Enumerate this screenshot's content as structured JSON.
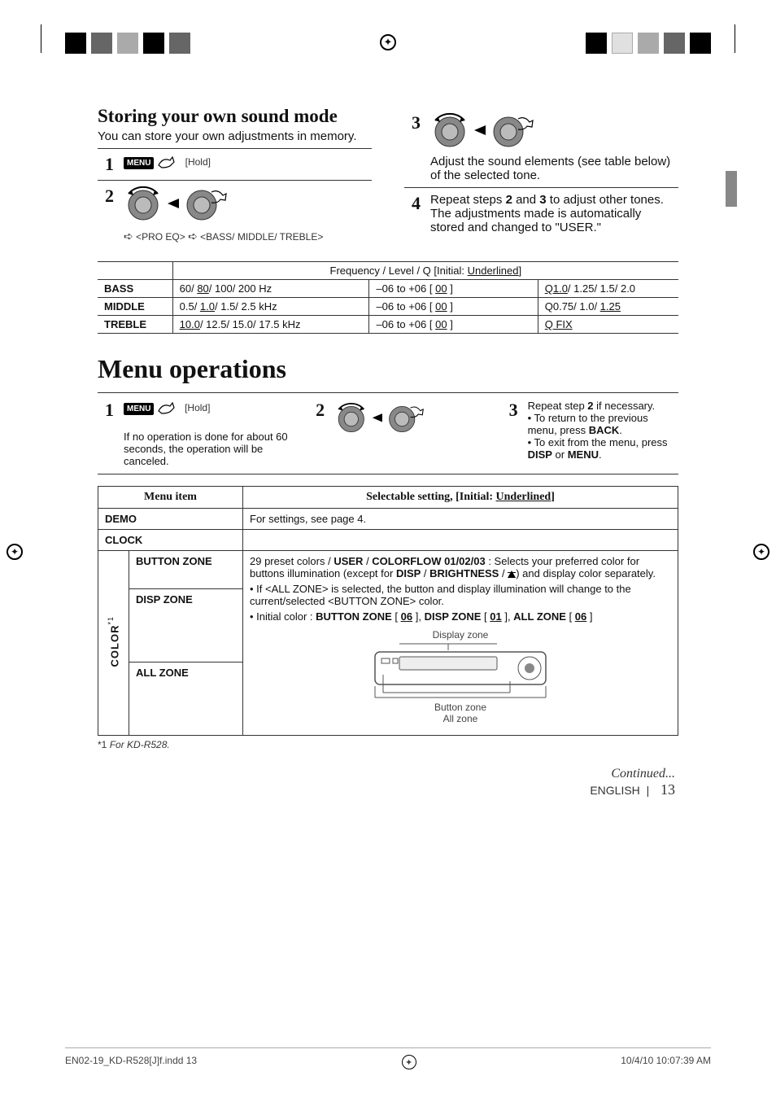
{
  "header": {
    "title": "Storing your own sound mode",
    "intro": "You can store your own adjustments in memory.",
    "steps": {
      "s1_hold": "[Hold]",
      "s2_path": " <PRO EQ>   <BASS/ MIDDLE/ TREBLE>",
      "s3": "Adjust the sound elements (see table below) of the selected tone.",
      "s4a": "Repeat steps ",
      "s4b": " and ",
      "s4c": " to adjust other tones.",
      "s4cont": "The adjustments made is automatically stored and changed to \"USER.\""
    },
    "step_nums": {
      "n1": "1",
      "n2": "2",
      "n3": "3",
      "n4": "4",
      "r2": "2",
      "r3": "3"
    }
  },
  "freq_table": {
    "header": "Frequency / Level / Q     [Initial: ",
    "header_u": "Underlined",
    "header_end": "]",
    "rows": [
      {
        "label": "BASS",
        "freq_pre": "60/ ",
        "freq_u": "80",
        "freq_post": "/ 100/ 200 Hz",
        "level_pre": "–06 to +06 [ ",
        "level_u": "00",
        "level_post": " ]",
        "q_u": "Q1.0",
        "q_post": "/ 1.25/ 1.5/ 2.0"
      },
      {
        "label": "MIDDLE",
        "freq_pre": "0.5/ ",
        "freq_u": "1.0",
        "freq_post": "/ 1.5/ 2.5 kHz",
        "level_pre": "–06 to +06 [ ",
        "level_u": "00",
        "level_post": " ]",
        "q_pre": "Q0.75/ 1.0/ ",
        "q_u": "1.25"
      },
      {
        "label": "TREBLE",
        "freq_u": "10.0",
        "freq_post": "/ 12.5/ 15.0/ 17.5 kHz",
        "level_pre": "–06 to +06 [ ",
        "level_u": "00",
        "level_post": " ]",
        "q_u": "Q FIX"
      }
    ]
  },
  "menu_ops": {
    "title": "Menu operations",
    "steps": {
      "n1": "1",
      "n2": "2",
      "n3": "3",
      "hold": "[Hold]",
      "s1_note": "If no operation is done for about 60 seconds, the operation will be canceled.",
      "s3a": "Repeat step ",
      "s3a_b": "2",
      "s3a_end": " if necessary.",
      "s3b_pre": "To return to the previous menu, press ",
      "s3b_bold": "BACK",
      "s3c_pre": "To exit from the menu, press ",
      "s3c_bold1": "DISP",
      "s3c_or": " or ",
      "s3c_bold2": "MENU"
    }
  },
  "menu_table": {
    "th_item": "Menu item",
    "th_setting_pre": "Selectable setting, [Initial: ",
    "th_setting_u": "Underlined",
    "th_setting_end": "]",
    "demo_label": "DEMO",
    "demo_text": "For settings, see page 4.",
    "clock_label": "CLOCK",
    "color_label": "COLOR",
    "color_sup": "*1",
    "sub_button": "BUTTON ZONE",
    "sub_disp": "DISP ZONE",
    "sub_all": "ALL ZONE",
    "color_text": {
      "l1a": "29 preset colors / ",
      "l1b": "USER",
      "l1c": " / ",
      "l1d": "COLORFLOW 01/02/03",
      "l1e": " : Selects your preferred color for buttons illumination (except for ",
      "l1f": "DISP",
      "l1g": " / ",
      "l1h": "BRIGHTNESS",
      "l1i": " / ",
      "l1j": ") and display color separately.",
      "l2a": "• If <ALL ZONE> is selected, the button and display illumination will change to the current/selected <BUTTON ZONE> color.",
      "l3a": "• Initial color : ",
      "l3b": "BUTTON ZONE",
      "l3c": " [ ",
      "l3c_u": "06",
      "l3d": " ], ",
      "l3e": "DISP ZONE",
      "l3f": " [ ",
      "l3f_u": "01",
      "l3g": " ], ",
      "l3h": "ALL ZONE",
      "l3i": " [ ",
      "l3i_u": "06",
      "l3j": " ]",
      "diag_display": "Display zone",
      "diag_button": "Button zone",
      "diag_all": "All zone"
    }
  },
  "footnote_pre": "*1  ",
  "footnote": "For KD-R528.",
  "footer": {
    "continued": "Continued...",
    "lang": "ENGLISH",
    "sep": "|",
    "page": "13"
  },
  "doc_footer": {
    "left": "EN02-19_KD-R528[J]f.indd   13",
    "right": "10/4/10   10:07:39 AM"
  }
}
